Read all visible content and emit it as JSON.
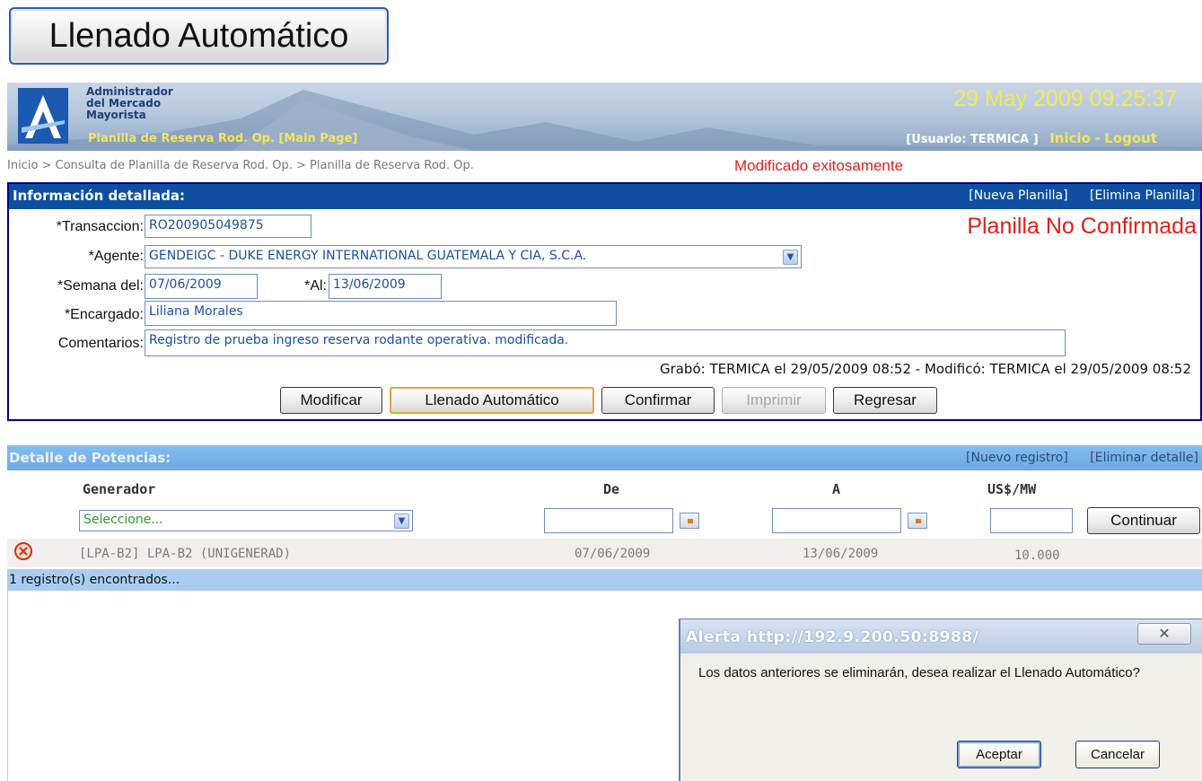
{
  "callout": {
    "label": "Llenado Automático"
  },
  "header": {
    "org_lines": [
      "Administrador",
      "del Mercado",
      "Mayorista"
    ],
    "title": "Planilla de Reserva Rod. Op. [Main Page]",
    "datetime": "29 May 2009 09:25:37",
    "user": "[Usuario: TERMICA ]",
    "home_link": "Inicio",
    "separator": "-",
    "logout_link": "Logout"
  },
  "breadcrumb": "Inicio > Consulta de Planilla de Reserva Rod. Op. > Planilla de Reserva Rod. Op.",
  "success_message": "Modificado exitosamente",
  "info": {
    "title": "Información detallada:",
    "new_link": "[Nueva Planilla]",
    "delete_link": "[Elimina Planilla]",
    "status": "Planilla No Confirmada",
    "fields": {
      "transaccion_label": "*Transaccion:",
      "transaccion_value": "RO200905049875",
      "agente_label": "*Agente:",
      "agente_value": "GENDEIGC - DUKE ENERGY INTERNATIONAL GUATEMALA Y CIA, S.C.A.",
      "semana_label": "*Semana del:",
      "semana_value": "07/06/2009",
      "al_label": "*Al:",
      "al_value": "13/06/2009",
      "encargado_label": "*Encargado:",
      "encargado_value": "Liliana Morales",
      "comentarios_label": "Comentarios:",
      "comentarios_value": "Registro de prueba ingreso reserva rodante operativa. modificada."
    },
    "audit": "Grabó: TERMICA el 29/05/2009 08:52 - Modificó: TERMICA el 29/05/2009 08:52",
    "buttons": {
      "modificar": "Modificar",
      "llenado": "Llenado Automático",
      "confirmar": "Confirmar",
      "imprimir": "Imprimir",
      "regresar": "Regresar"
    }
  },
  "detail": {
    "title": "Detalle de Potencias:",
    "new_link": "[Nuevo registro]",
    "delete_link": "[Eliminar detalle]",
    "columns": {
      "generador": "Generador",
      "de": "De",
      "a": "A",
      "usd": "US$/MW"
    },
    "new_row": {
      "generador_placeholder": "Seleccione...",
      "continue_label": "Continuar"
    },
    "rows": [
      {
        "generador": "[LPA-B2] LPA-B2 (UNIGENERAD)",
        "de": "07/06/2009",
        "a": "13/06/2009",
        "usd": "10.000"
      }
    ],
    "count": "1 registro(s) encontrados..."
  },
  "dialog": {
    "title": "Alerta http://192.9.200.50:8988/",
    "close": "✕",
    "message": "Los datos anteriores se eliminarán, desea realizar el Llenado Automático?",
    "accept": "Aceptar",
    "cancel": "Cancelar"
  }
}
